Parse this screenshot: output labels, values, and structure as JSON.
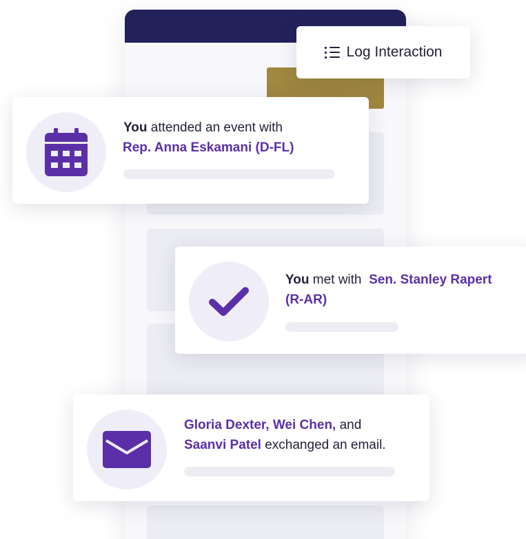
{
  "log_button": {
    "label": "Log Interaction",
    "icon": "list-icon"
  },
  "cards": [
    {
      "icon": "calendar-icon",
      "parts": [
        "You",
        " attended an event with",
        "Rep. Anna Eskamani (D-FL)"
      ]
    },
    {
      "icon": "checkmark-icon",
      "parts": [
        "You",
        " met with",
        "Sen. Stanley Rapert",
        "(R-AR)"
      ]
    },
    {
      "icon": "envelope-icon",
      "parts": [
        "Gloria Dexter, Wei Chen,",
        " and",
        "Saanvi Patel",
        " exchanged an email."
      ]
    }
  ],
  "colors": {
    "header": "#23215a",
    "accent_gold": "#a08840",
    "accent_purple": "#5b2fa8",
    "icon_bg": "#efeef8",
    "text": "#23213c"
  }
}
